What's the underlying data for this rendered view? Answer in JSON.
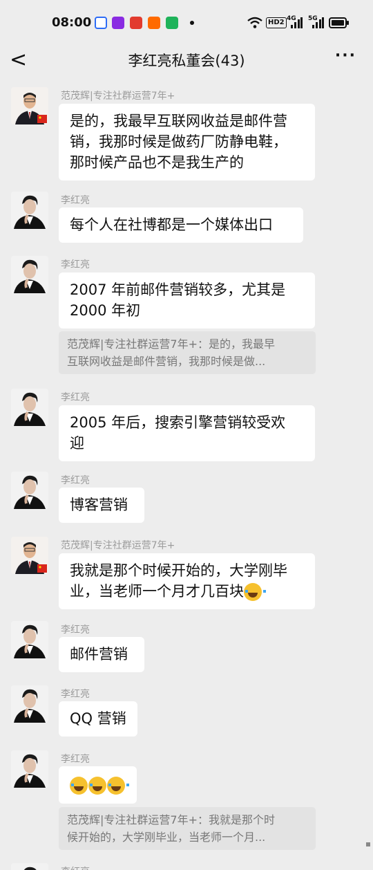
{
  "status_bar": {
    "time": "08:00",
    "app_icons": [
      "baidu-icon",
      "video-app-icon",
      "news-app-icon",
      "kuaishou-icon",
      "tv-app-icon"
    ],
    "right": {
      "hd": "HD2",
      "net1": "4G",
      "net2": "5G"
    }
  },
  "header": {
    "back_label": "<",
    "title": "李红亮私董会(43)",
    "more_label": "···"
  },
  "messages": [
    {
      "sender": "范茂辉|专注社群运营7年+",
      "lines": [
        "是的，我最早互联网收益是邮件营",
        "销，我那时候是做药厂防静电鞋，",
        "那时候产品也不是我生产的"
      ]
    },
    {
      "sender": "李红亮",
      "lines": [
        "每个人在社博都是一个媒体出口"
      ]
    },
    {
      "sender": "李红亮",
      "lines": [
        "2007 年前邮件营销较多，尤其是",
        "2000 年初"
      ],
      "quote": [
        "范茂辉|专注社群运营7年+：是的，我最早",
        "互联网收益是邮件营销，我那时候是做..."
      ]
    },
    {
      "sender": "李红亮",
      "lines": [
        "2005 年后，搜索引擎营销较受欢",
        "迎"
      ]
    },
    {
      "sender": "李红亮",
      "lines": [
        "博客营销"
      ]
    },
    {
      "sender": "范茂辉|专注社群运营7年+",
      "lines": [
        "我就是那个时候开始的，大学刚毕",
        "业，当老师一个月才几百块"
      ]
    },
    {
      "sender": "李红亮",
      "lines": [
        "邮件营销"
      ]
    },
    {
      "sender": "李红亮",
      "lines": [
        "QQ 营销"
      ]
    },
    {
      "sender": "李红亮",
      "quote": [
        "范茂辉|专注社群运营7年+：我就是那个时",
        "候开始的，大学刚毕业，当老师一个月..."
      ]
    },
    {
      "sender": "李红亮"
    }
  ],
  "colors": {
    "background": "#ededed",
    "bubble": "#ffffff",
    "quote": "#e3e3e3",
    "sender": "#9b9b9b"
  }
}
